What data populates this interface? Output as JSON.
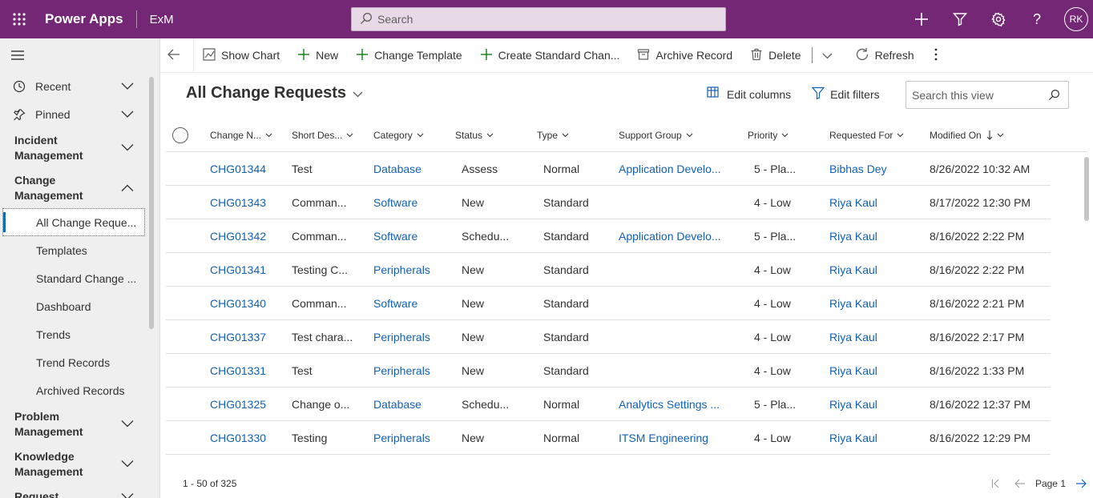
{
  "topbar": {
    "app_name": "Power Apps",
    "environment": "ExM",
    "search_placeholder": "Search",
    "avatar_initials": "RK",
    "brand_color": "#742774"
  },
  "sidebar": {
    "recent": "Recent",
    "pinned": "Pinned",
    "incident_management": "Incident Management",
    "change_management": "Change Management",
    "change_items": [
      "All Change Reque...",
      "Templates",
      "Standard Change ...",
      "Dashboard",
      "Trends",
      "Trend Records",
      "Archived Records"
    ],
    "problem_management": "Problem Management",
    "knowledge_management": "Knowledge Management",
    "request": "Request"
  },
  "commands": {
    "show_chart": "Show Chart",
    "new": "New",
    "change_template": "Change Template",
    "create_standard_change": "Create Standard Chan...",
    "archive_record": "Archive Record",
    "delete": "Delete",
    "refresh": "Refresh"
  },
  "view": {
    "title": "All Change Requests",
    "edit_columns": "Edit columns",
    "edit_filters": "Edit filters",
    "search_placeholder": "Search this view"
  },
  "grid": {
    "columns": [
      "Change N...",
      "Short Des...",
      "Category",
      "Status",
      "Type",
      "Support Group",
      "Priority",
      "Requested For",
      "Modified On"
    ],
    "rows": [
      [
        "CHG01344",
        "Test",
        "Database",
        "Assess",
        "Normal",
        "Application Develo...",
        "5 - Pla...",
        "Bibhas Dey",
        "8/26/2022 10:32 AM"
      ],
      [
        "CHG01343",
        "Comman...",
        "Software",
        "New",
        "Standard",
        "",
        "4 - Low",
        "Riya Kaul",
        "8/17/2022 12:30 PM"
      ],
      [
        "CHG01342",
        "Comman...",
        "Software",
        "Schedu...",
        "Standard",
        "Application Develo...",
        "5 - Pla...",
        "Riya Kaul",
        "8/16/2022 2:22 PM"
      ],
      [
        "CHG01341",
        "Testing C...",
        "Peripherals",
        "New",
        "Standard",
        "",
        "4 - Low",
        "Riya Kaul",
        "8/16/2022 2:22 PM"
      ],
      [
        "CHG01340",
        "Comman...",
        "Software",
        "New",
        "Standard",
        "",
        "4 - Low",
        "Riya Kaul",
        "8/16/2022 2:21 PM"
      ],
      [
        "CHG01337",
        "Test chara...",
        "Peripherals",
        "New",
        "Standard",
        "",
        "4 - Low",
        "Riya Kaul",
        "8/16/2022 2:17 PM"
      ],
      [
        "CHG01331",
        "Test",
        "Peripherals",
        "New",
        "Standard",
        "",
        "4 - Low",
        "Riya Kaul",
        "8/16/2022 1:33 PM"
      ],
      [
        "CHG01325",
        "Change o...",
        "Database",
        "Schedu...",
        "Normal",
        "Analytics Settings ...",
        "5 - Pla...",
        "Riya Kaul",
        "8/16/2022 12:37 PM"
      ],
      [
        "CHG01330",
        "Testing",
        "Peripherals",
        "New",
        "Normal",
        "ITSM Engineering",
        "4 - Low",
        "Riya Kaul",
        "8/16/2022 12:29 PM"
      ]
    ]
  },
  "footer": {
    "record_count": "1 - 50 of 325",
    "page": "Page 1"
  }
}
